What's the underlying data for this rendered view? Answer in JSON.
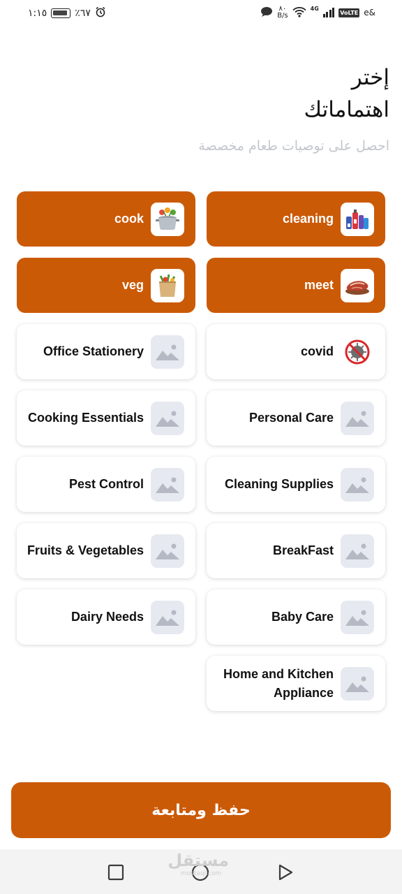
{
  "status_bar": {
    "time": "١:١٥",
    "battery": "٪٦٧",
    "network_speed_value": "٨٠",
    "network_speed_unit": "B/s",
    "network_type": "4G",
    "volte": "VoLTE",
    "carrier": "e&"
  },
  "header": {
    "title_line1": "إختر",
    "title_line2": "اهتماماتك",
    "subtitle": "احصل على توصيات طعام مخصصة"
  },
  "interests": [
    {
      "label": "cleaning",
      "selected": true,
      "icon": "cleaning-products-image"
    },
    {
      "label": "cook",
      "selected": true,
      "icon": "cooking-pot-image"
    },
    {
      "label": "meet",
      "selected": true,
      "icon": "meat-image"
    },
    {
      "label": "veg",
      "selected": true,
      "icon": "vegetable-bag-image"
    },
    {
      "label": "covid",
      "selected": false,
      "icon": "no-covid-icon"
    },
    {
      "label": "Office Stationery",
      "selected": false,
      "icon": "image-placeholder-icon"
    },
    {
      "label": "Personal Care",
      "selected": false,
      "icon": "image-placeholder-icon"
    },
    {
      "label": "Cooking Essentials",
      "selected": false,
      "icon": "image-placeholder-icon"
    },
    {
      "label": "Cleaning Supplies",
      "selected": false,
      "icon": "image-placeholder-icon"
    },
    {
      "label": "Pest Control",
      "selected": false,
      "icon": "image-placeholder-icon"
    },
    {
      "label": "BreakFast",
      "selected": false,
      "icon": "image-placeholder-icon"
    },
    {
      "label": "Fruits & Vegetables",
      "selected": false,
      "icon": "image-placeholder-icon"
    },
    {
      "label": "Baby Care",
      "selected": false,
      "icon": "image-placeholder-icon"
    },
    {
      "label": "Dairy Needs",
      "selected": false,
      "icon": "image-placeholder-icon"
    },
    {
      "label": "Home and Kitchen Appliance",
      "selected": false,
      "icon": "image-placeholder-icon"
    }
  ],
  "save_button_label": "حفظ ومتابعة",
  "watermark": {
    "arabic": "مستقل",
    "latin": "mostaql.com"
  },
  "colors": {
    "accent": "#cb5a07",
    "placeholder_bg": "#e6e9f0",
    "subtitle": "#c3c6cc"
  }
}
